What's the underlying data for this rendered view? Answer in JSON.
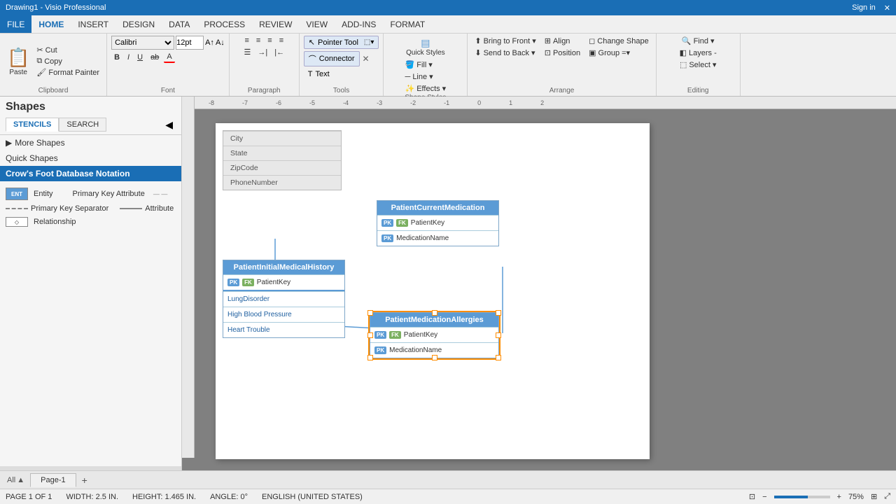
{
  "titleBar": {
    "title": "Drawing1 - Visio Professional",
    "signIn": "Sign in",
    "closeBtn": "✕"
  },
  "menuBar": {
    "items": [
      "FILE",
      "HOME",
      "INSERT",
      "DESIGN",
      "DATA",
      "PROCESS",
      "REVIEW",
      "VIEW",
      "ADD-INS",
      "FORMAT"
    ]
  },
  "ribbon": {
    "clipboard": {
      "label": "Clipboard",
      "paste": "Paste",
      "cut": "Cut",
      "copy": "Copy",
      "formatPainter": "Format Painter"
    },
    "font": {
      "label": "Font",
      "fontFamily": "Calibri",
      "fontSize": "12pt",
      "bold": "B",
      "italic": "I",
      "underline": "U",
      "strikethrough": "ab",
      "fontColor": "A"
    },
    "paragraph": {
      "label": "Paragraph"
    },
    "tools": {
      "label": "Tools",
      "pointerTool": "Pointer Tool",
      "connector": "Connector",
      "text": "Text",
      "closeConnector": "✕"
    },
    "shapeStyles": {
      "label": "Shape Styles",
      "fill": "Fill",
      "line": "Line",
      "effects": "Effects",
      "quickStyles": "Quick Styles"
    },
    "arrange": {
      "label": "Arrange",
      "bringToFront": "Bring to Front",
      "sendToBack": "Send to Back",
      "align": "Align",
      "position": "Position",
      "group": "Group",
      "changeShape": "Change Shape"
    },
    "editing": {
      "label": "Editing",
      "find": "Find",
      "layers": "Layers -",
      "select": "Select"
    }
  },
  "sidebar": {
    "title": "Shapes",
    "tabs": [
      "STENCILS",
      "SEARCH"
    ],
    "sections": [
      "More Shapes",
      "Quick Shapes",
      "Crow's Foot Database Notation"
    ],
    "stencilItems": [
      {
        "type": "entity",
        "label": "Entity"
      },
      {
        "type": "pkattr",
        "label": "Primary Key Attribute"
      },
      {
        "type": "pksep",
        "label": "Primary Key Separator"
      },
      {
        "type": "attr",
        "label": "Attribute"
      },
      {
        "type": "rel",
        "label": "Relationship"
      }
    ]
  },
  "canvas": {
    "grayTable": {
      "rows": [
        "City",
        "State",
        "ZipCode",
        "PhoneNumber"
      ]
    },
    "patientHistoryTable": {
      "header": "PatientInitialMedicalHistory",
      "rows": [
        {
          "badges": [
            "PK",
            "FK"
          ],
          "name": "PatientKey"
        },
        {
          "badges": [],
          "name": "LungDisorder"
        },
        {
          "badges": [],
          "name": "High Blood Pressure"
        },
        {
          "badges": [],
          "name": "Heart Trouble"
        }
      ]
    },
    "patientCurrentMedTable": {
      "header": "PatientCurrentMedication",
      "rows": [
        {
          "badges": [
            "PK",
            "FK"
          ],
          "name": "PatientKey"
        },
        {
          "badges": [
            "PK"
          ],
          "name": "MedicationName"
        }
      ]
    },
    "patientMedAllergiesTable": {
      "header": "PatientMedicationAllergies",
      "rows": [
        {
          "badges": [
            "PK",
            "FK"
          ],
          "name": "PatientKey"
        },
        {
          "badges": [
            "PK"
          ],
          "name": "MedicationName"
        }
      ],
      "selected": true
    }
  },
  "pageTabs": {
    "current": "Page-1",
    "all": "All",
    "add": "+"
  },
  "statusBar": {
    "page": "PAGE 1 OF 1",
    "width": "WIDTH: 2.5 IN.",
    "height": "HEIGHT: 1.465 IN.",
    "angle": "ANGLE: 0°",
    "language": "ENGLISH (UNITED STATES)",
    "zoom": "75%"
  }
}
